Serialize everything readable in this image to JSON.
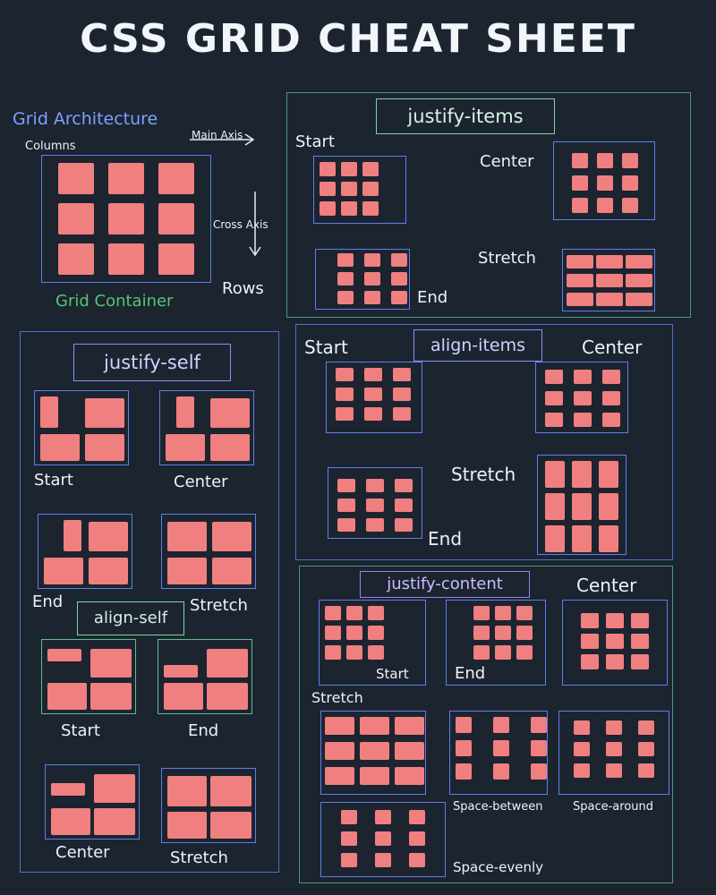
{
  "title": "CSS GRID CHEAT SHEET",
  "colors": {
    "background": "#1c2430",
    "cell": "#f07f80",
    "box_border": "#5d7fe8",
    "panel_green": "#4a9a7a",
    "panel_blue": "#4e6fd0",
    "label_blue": "#7fa0ff",
    "label_green": "#58c472"
  },
  "architecture": {
    "title": "Grid Architecture",
    "columns": "Columns",
    "main_axis": "Main Axis",
    "cross_axis": "Cross Axis",
    "rows": "Rows",
    "container": "Grid Container"
  },
  "justify_items": {
    "heading": "justify-items",
    "start": "Start",
    "center": "Center",
    "stretch": "Stretch",
    "end": "End"
  },
  "justify_self": {
    "heading": "justify-self",
    "start": "Start",
    "center": "Center",
    "end": "End",
    "stretch": "Stretch"
  },
  "align_self": {
    "heading": "align-self",
    "start": "Start",
    "end": "End",
    "center": "Center",
    "stretch": "Stretch"
  },
  "align_items": {
    "heading": "align-items",
    "start": "Start",
    "center": "Center",
    "stretch": "Stretch",
    "end": "End"
  },
  "justify_content": {
    "heading": "justify-content",
    "center": "Center",
    "start": "Start",
    "end": "End",
    "stretch": "Stretch",
    "space_between": "Space-between",
    "space_around": "Space-around",
    "space_evenly": "Space-evenly"
  }
}
